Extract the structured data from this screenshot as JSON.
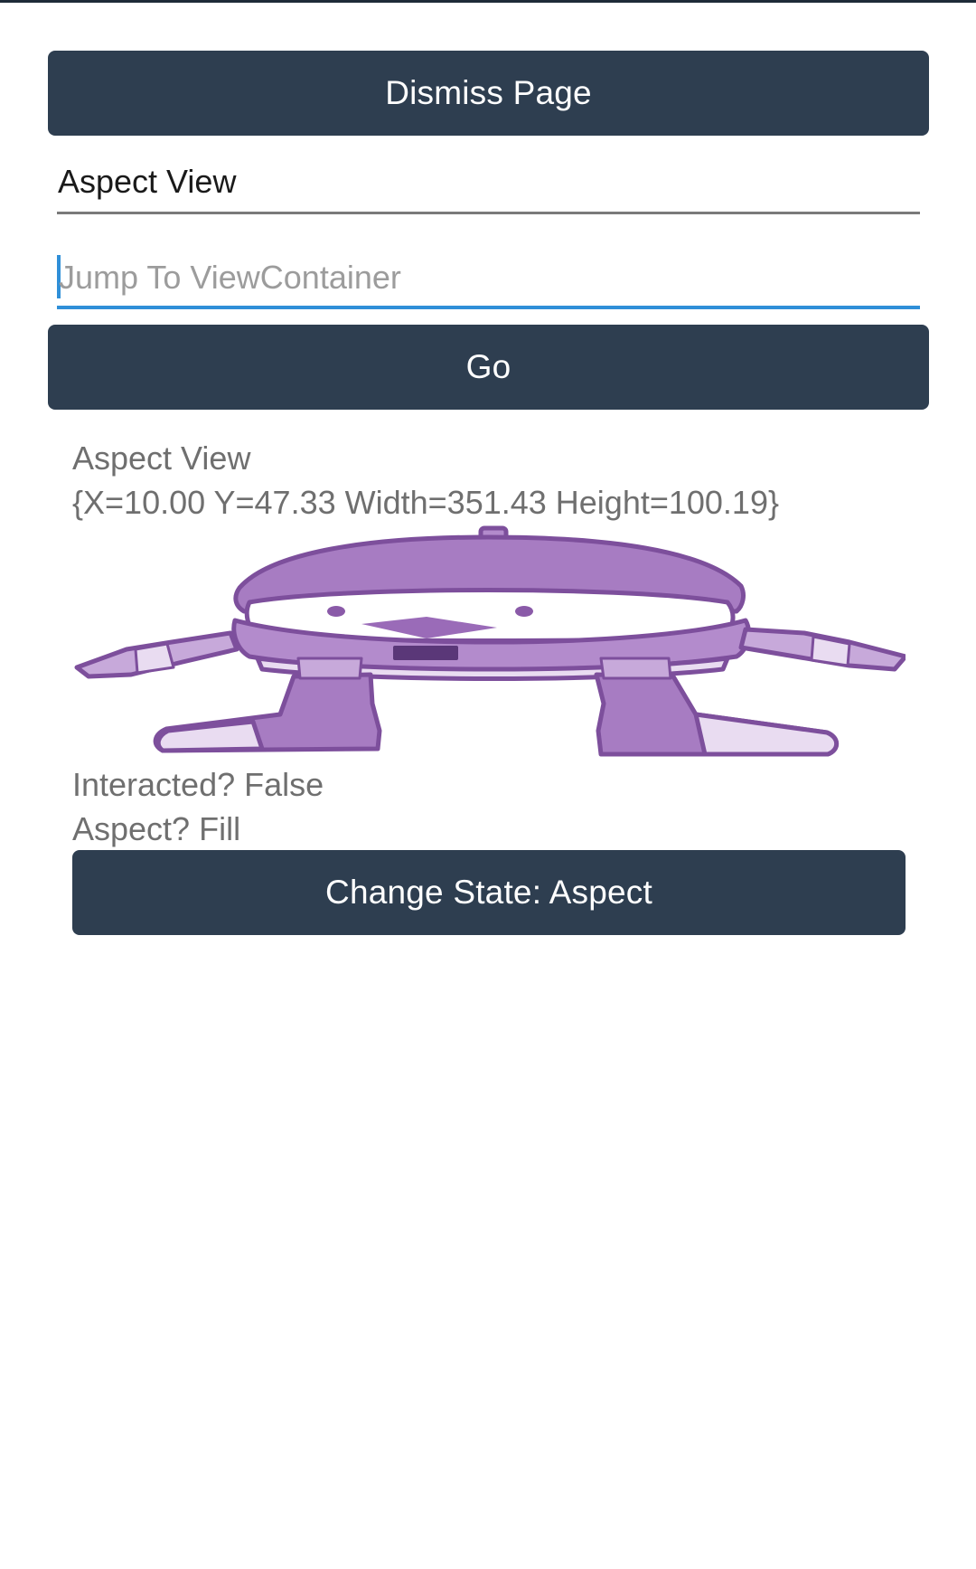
{
  "top_button": {
    "label": "Dismiss Page"
  },
  "aspect_entry": {
    "value": "Aspect View"
  },
  "jump_entry": {
    "placeholder": "Jump To ViewContainer",
    "value": ""
  },
  "go_button": {
    "label": "Go"
  },
  "view_container": {
    "title": "Aspect View",
    "bounds_text": "{X=10.00 Y=47.33 Width=351.43 Height=100.19}",
    "image_icon": "robot-mascot-icon",
    "interacted_text": "Interacted? False",
    "aspect_text": "Aspect? Fill",
    "change_button_label": "Change State: Aspect"
  },
  "colors": {
    "button_bg": "#2e3e50",
    "button_text": "#ffffff",
    "focus_underline": "#2f8fd8",
    "mascot_purple": "#a77cc2"
  }
}
